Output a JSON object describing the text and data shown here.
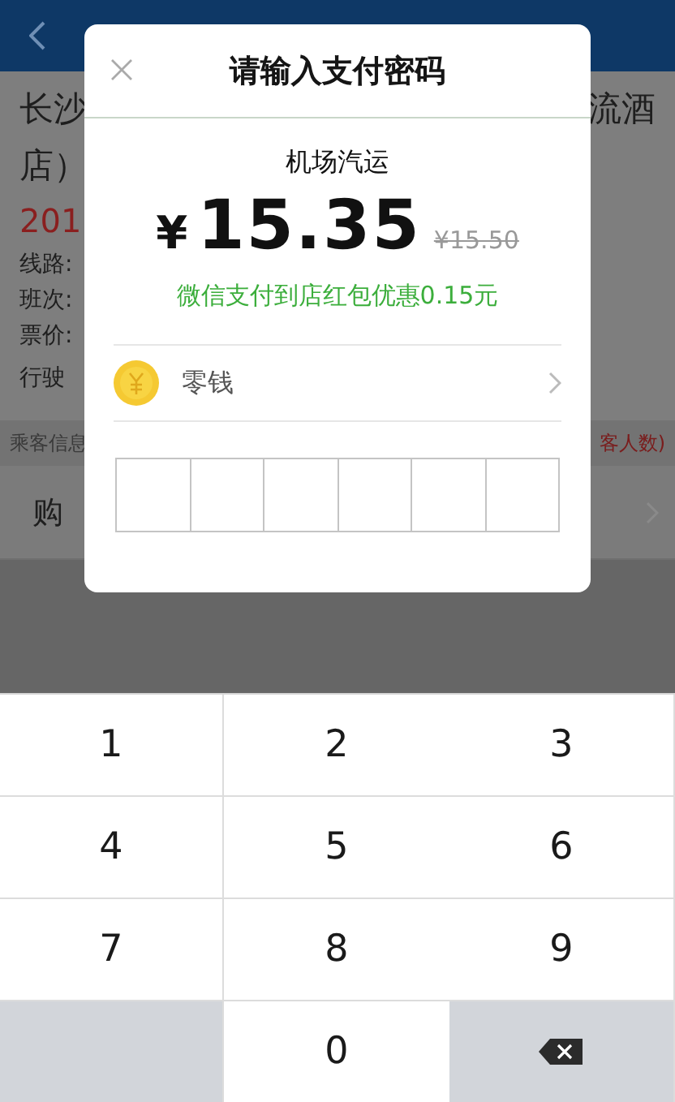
{
  "background_page": {
    "title_lines": [
      {
        "left": "长沙",
        "right": "流酒"
      },
      {
        "left": "店）"
      }
    ],
    "date": "201",
    "details": [
      "线路:",
      "班次:",
      "票价:",
      "行驶"
    ],
    "passenger_bar": {
      "label": "乘客信息",
      "note": "客人数)"
    },
    "purchase_row": {
      "label": "购"
    }
  },
  "dialog": {
    "title": "请输入支付密码",
    "merchant": "机场汽运",
    "currency": "¥",
    "amount": "15.35",
    "original_price": "¥15.50",
    "discount": "微信支付到店红包优惠0.15元",
    "payment_method": "零钱",
    "password_slots": [
      {
        "filled": false
      },
      {
        "filled": false
      },
      {
        "filled": false
      },
      {
        "filled": false
      },
      {
        "filled": false
      },
      {
        "filled": false
      }
    ]
  },
  "keypad": {
    "keys": [
      {
        "kind": "digit",
        "label": "1"
      },
      {
        "kind": "digit",
        "label": "2"
      },
      {
        "kind": "digit",
        "label": "3"
      },
      {
        "kind": "digit",
        "label": "4"
      },
      {
        "kind": "digit",
        "label": "5"
      },
      {
        "kind": "digit",
        "label": "6"
      },
      {
        "kind": "digit",
        "label": "7"
      },
      {
        "kind": "digit",
        "label": "8"
      },
      {
        "kind": "digit",
        "label": "9"
      },
      {
        "kind": "blank"
      },
      {
        "kind": "digit",
        "label": "0"
      },
      {
        "kind": "delete"
      }
    ]
  }
}
